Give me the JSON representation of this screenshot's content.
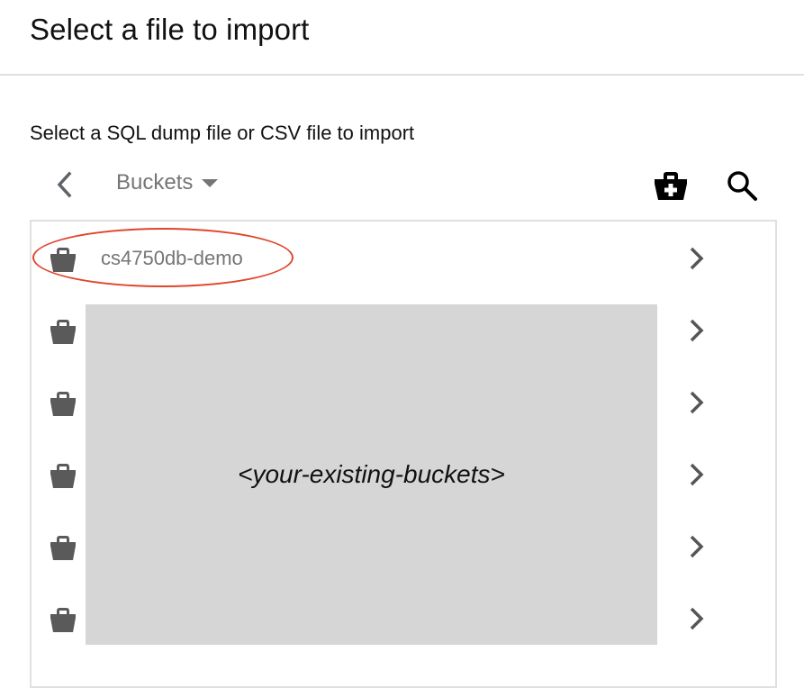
{
  "dialog": {
    "title": "Select a file to import",
    "subtitle": "Select a SQL dump file or CSV file to import"
  },
  "toolbar": {
    "back_icon": "chevron-left-icon",
    "breadcrumb_label": "Buckets",
    "breadcrumb_dropdown_icon": "caret-down-icon",
    "create_bucket_icon": "add-bucket-icon",
    "search_icon": "search-icon"
  },
  "buckets": [
    {
      "name": "cs4750db-demo",
      "icon": "bucket-icon",
      "highlighted": true
    },
    {
      "name": "",
      "icon": "bucket-icon"
    },
    {
      "name": "",
      "icon": "bucket-icon"
    },
    {
      "name": "",
      "icon": "bucket-icon"
    },
    {
      "name": "",
      "icon": "bucket-icon"
    },
    {
      "name": "",
      "icon": "bucket-icon"
    }
  ],
  "redacted_placeholder": "<your-existing-buckets>",
  "colors": {
    "highlight": "#e0462c",
    "icon": "#5a5a5a",
    "muted_text": "#757575",
    "redaction": "#d6d6d6"
  }
}
